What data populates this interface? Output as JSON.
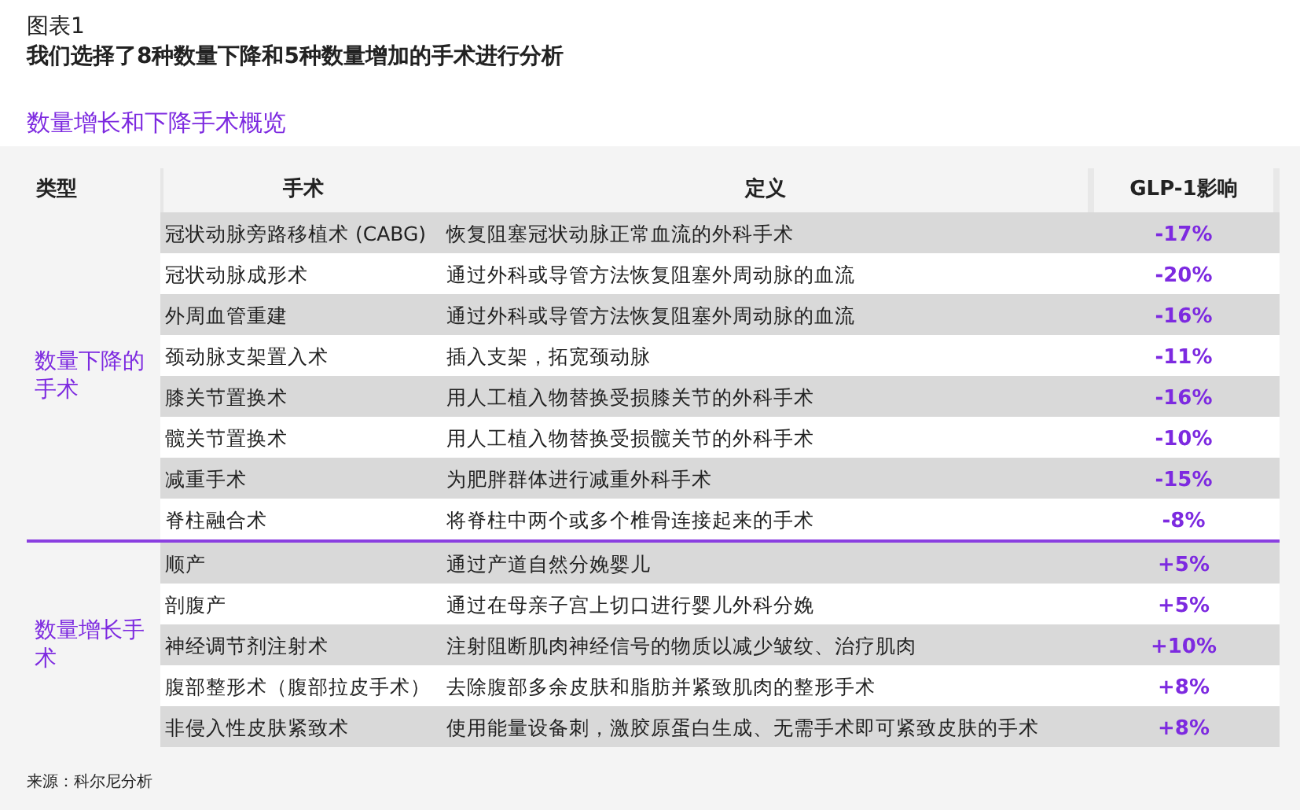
{
  "figure_label": "图表1",
  "title": "我们选择了8种数量下降和5种数量增加的手术进行分析",
  "subtitle": "数量增长和下降手术概览",
  "table": {
    "columns": [
      "类型",
      "手术",
      "定义",
      "GLP-1影响"
    ],
    "groups": [
      {
        "type": "数量下降的手术",
        "rows": [
          {
            "procedure": "冠状动脉旁路移植术 (CABG)",
            "definition": "恢复阻塞冠状动脉正常血流的外科手术",
            "impact": "-17%"
          },
          {
            "procedure": "冠状动脉成形术",
            "definition": "通过外科或导管方法恢复阻塞外周动脉的血流",
            "impact": "-20%"
          },
          {
            "procedure": "外周血管重建",
            "definition": "通过外科或导管方法恢复阻塞外周动脉的血流",
            "impact": "-16%"
          },
          {
            "procedure": "颈动脉支架置入术",
            "definition": "插入支架，拓宽颈动脉",
            "impact": "-11%"
          },
          {
            "procedure": "膝关节置换术",
            "definition": "用人工植入物替换受损膝关节的外科手术",
            "impact": "-16%"
          },
          {
            "procedure": "髋关节置换术",
            "definition": "用人工植入物替换受损髋关节的外科手术",
            "impact": "-10%"
          },
          {
            "procedure": "减重手术",
            "definition": "为肥胖群体进行减重外科手术",
            "impact": "-15%"
          },
          {
            "procedure": "脊柱融合术",
            "definition": "将脊柱中两个或多个椎骨连接起来的手术",
            "impact": "-8%"
          }
        ]
      },
      {
        "type": "数量增长手术",
        "rows": [
          {
            "procedure": "顺产",
            "definition": "通过产道自然分娩婴儿",
            "impact": "+5%"
          },
          {
            "procedure": "剖腹产",
            "definition": "通过在母亲子宫上切口进行婴儿外科分娩",
            "impact": "+5%"
          },
          {
            "procedure": "神经调节剂注射术",
            "definition": "注射阻断肌肉神经信号的物质以减少皱纹、治疗肌肉",
            "impact": "+10%"
          },
          {
            "procedure": "腹部整形术（腹部拉皮手术）",
            "definition": "去除腹部多余皮肤和脂肪并紧致肌肉的整形手术",
            "impact": "+8%"
          },
          {
            "procedure": "非侵入性皮肤紧致术",
            "definition": "使用能量设备刺，激胶原蛋白生成、无需手术即可紧致皮肤的手术",
            "impact": "+8%"
          }
        ]
      }
    ]
  },
  "source": "来源：科尔尼分析"
}
